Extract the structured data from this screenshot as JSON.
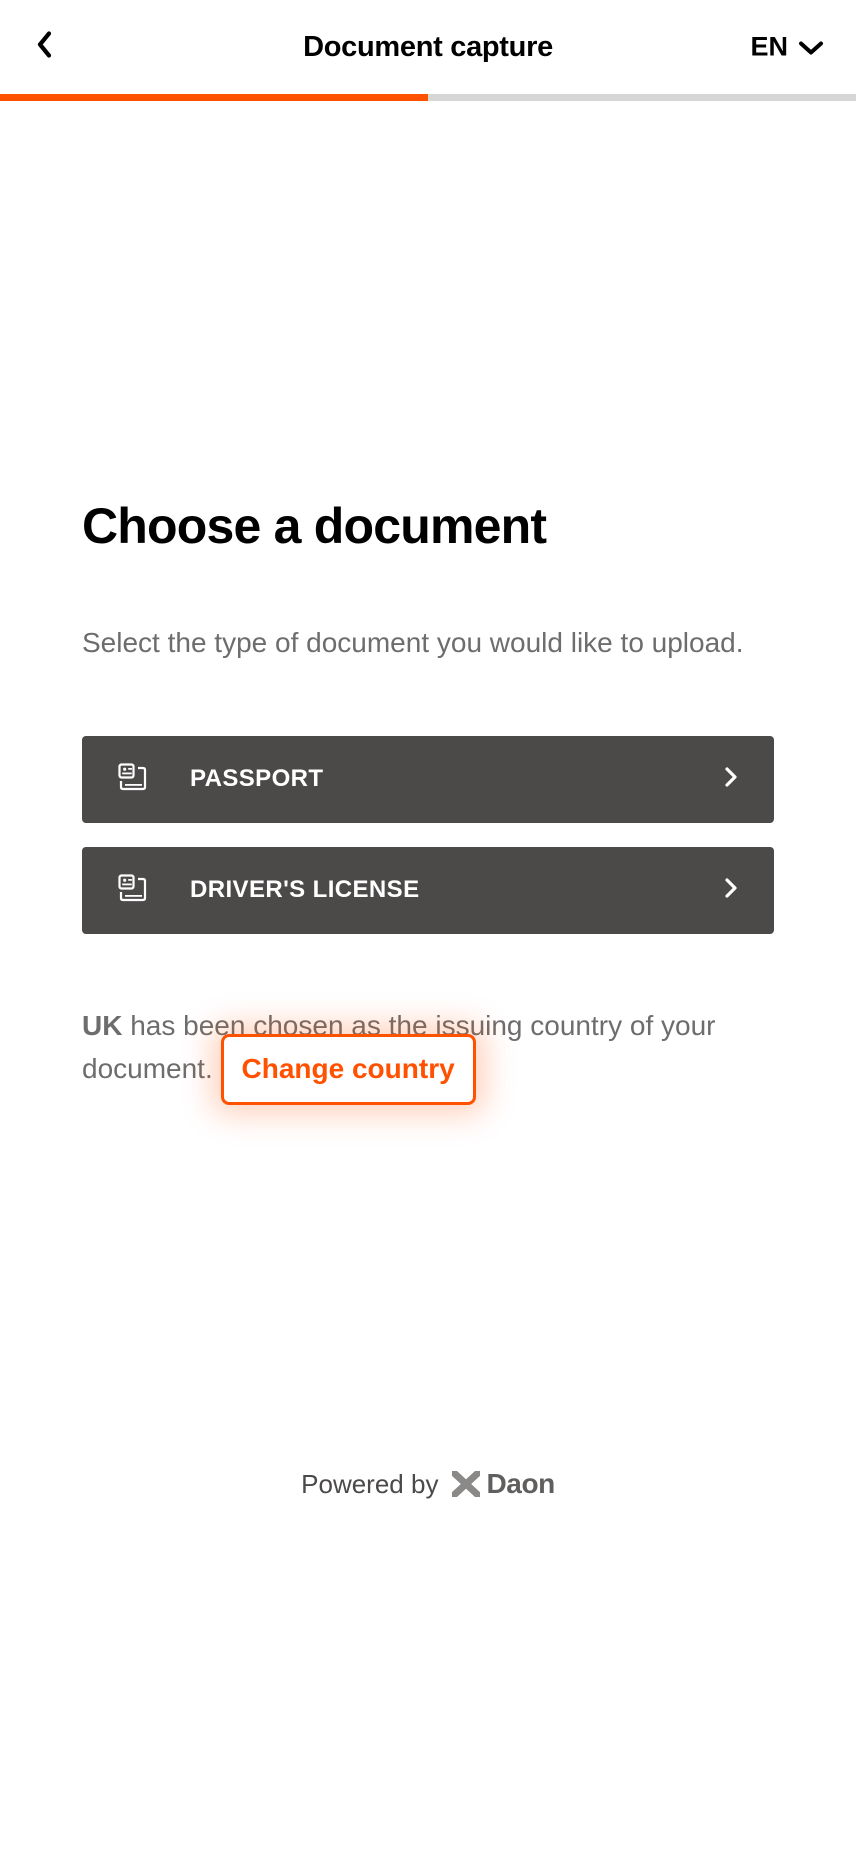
{
  "header": {
    "title": "Document capture",
    "language": "EN"
  },
  "progress": {
    "percent": 50,
    "accent": "#ff5100",
    "track": "#d7d6d6"
  },
  "main": {
    "heading": "Choose a document",
    "subheading": "Select the type of document you would like to upload.",
    "documents": [
      {
        "label": "PASSPORT",
        "name": "passport"
      },
      {
        "label": "DRIVER'S LICENSE",
        "name": "drivers-license"
      }
    ],
    "country_note": {
      "country": "UK",
      "text_before": " has been chosen as the issuing country of your document. ",
      "change_label": "Change country"
    }
  },
  "footer": {
    "powered_by": "Powered by",
    "brand": "Daon"
  }
}
